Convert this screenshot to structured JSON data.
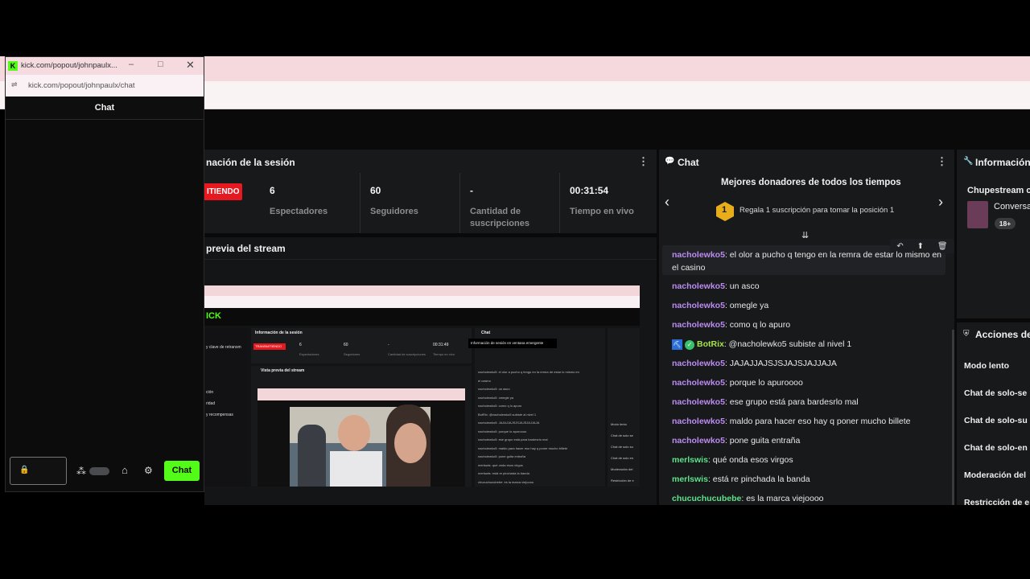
{
  "popout": {
    "tab_title": "kick.com/popout/johnpaulx...",
    "url": "kick.com/popout/johnpaulx/chat",
    "header": "Chat",
    "send_label": "Chat"
  },
  "session": {
    "title": "nación de la sesión",
    "live_label": "ITIENDO",
    "stats": [
      {
        "value": "6",
        "label": "Espectadores"
      },
      {
        "value": "60",
        "label": "Seguidores"
      },
      {
        "value": "-",
        "label": "Cantidad de suscripciones"
      },
      {
        "value": "00:31:54",
        "label": "Tiempo en vivo"
      }
    ]
  },
  "preview": {
    "title": "previa del stream"
  },
  "chat": {
    "title": "Chat",
    "donors_title": "Mejores donadores de todos los tiempos",
    "rank": "1",
    "donors_cta": "Regala 1 suscripción para tomar la posición 1",
    "messages": [
      {
        "user": "nacholewko5",
        "text": ": el olor a pucho q tengo en la remra de estar lo mismo en",
        "cont": "el casino",
        "color": "purple"
      },
      {
        "user": "nacholewko5",
        "text": ": un asco",
        "color": "purple"
      },
      {
        "user": "nacholewko5",
        "text": ": omegle ya",
        "color": "purple"
      },
      {
        "user": "nacholewko5",
        "text": ": como q lo apuro",
        "color": "purple"
      },
      {
        "user": "BotRix",
        "text": ": @nacholewko5 subiste al nivel 1",
        "color": "botrix"
      },
      {
        "user": "nacholewko5",
        "text": ": JAJAJJAJSJSJAJSJAJJAJA",
        "color": "purple"
      },
      {
        "user": "nacholewko5",
        "text": ": porque lo apuroooo",
        "color": "purple"
      },
      {
        "user": "nacholewko5",
        "text": ": ese grupo está para bardesrlo mal",
        "color": "purple"
      },
      {
        "user": "nacholewko5",
        "text": ": maldo para hacer eso hay q poner mucho billete",
        "color": "purple"
      },
      {
        "user": "nacholewko5",
        "text": ": pone guita entraña",
        "color": "purple"
      },
      {
        "user": "merlswis",
        "text": ": qué onda esos virgos",
        "color": "green"
      },
      {
        "user": "merlswis",
        "text": ": está re pinchada la banda",
        "color": "green"
      },
      {
        "user": "chucuchucubebe",
        "text": ": es la marca viejoooo",
        "color": "green"
      }
    ]
  },
  "info": {
    "title": "Información",
    "stream_title": "Chupestream c",
    "category": "Conversa",
    "badge": "18+"
  },
  "actions": {
    "title": "Acciones de",
    "items": [
      "Modo lento",
      "Chat de solo-se",
      "Chat de solo-su",
      "Chat de solo-en",
      "Moderación del",
      "Restricción de e"
    ]
  },
  "mini_preview": {
    "session_title": "Información de la sesión",
    "live": "TRANSMITIENDO",
    "vals": [
      "6",
      "60",
      "-",
      "00:31:49"
    ],
    "labs": [
      "Espectadores",
      "Seguidores",
      "Cantidad de suscripciones",
      "Tiempo en vivo"
    ],
    "preview_title": "Vista previa del stream",
    "chat_title": "Chat",
    "popup": "Información de sesión en ventana emergente",
    "side_items": [
      "y clave de retransm",
      "ción",
      "ridad",
      "y recompensas"
    ],
    "right_items": [
      "Modo lento",
      "Chat de solo se",
      "Chat de solo su",
      "Chat de solo en",
      "Moderación del",
      "Restricción de e"
    ],
    "chat_lines": [
      "nacholewko5: el olor a pucho q tengo en la remra de estar lo mismo en",
      "el casino",
      "nacholewko5: un asco",
      "nacholewko5: omegle ya",
      "nacholewko5: como q lo apuro",
      "BotRix: @nacholewko5 subiste al nivel 1",
      "nacholewko5: JAJAJJAJSJSJAJSJAJJAJA",
      "nacholewko5: porque lo apuroooo",
      "nacholewko5: ese grupo está para bardesrlo mal",
      "nacholewko5: maldo para hacer eso hay q poner mucho billete",
      "nacholewko5: pone guita entraña",
      "merlswis: qué onda esos virgos",
      "merlswis: está re pinchada la banda",
      "chucuchucubebe: es la marca viejoooo"
    ]
  }
}
